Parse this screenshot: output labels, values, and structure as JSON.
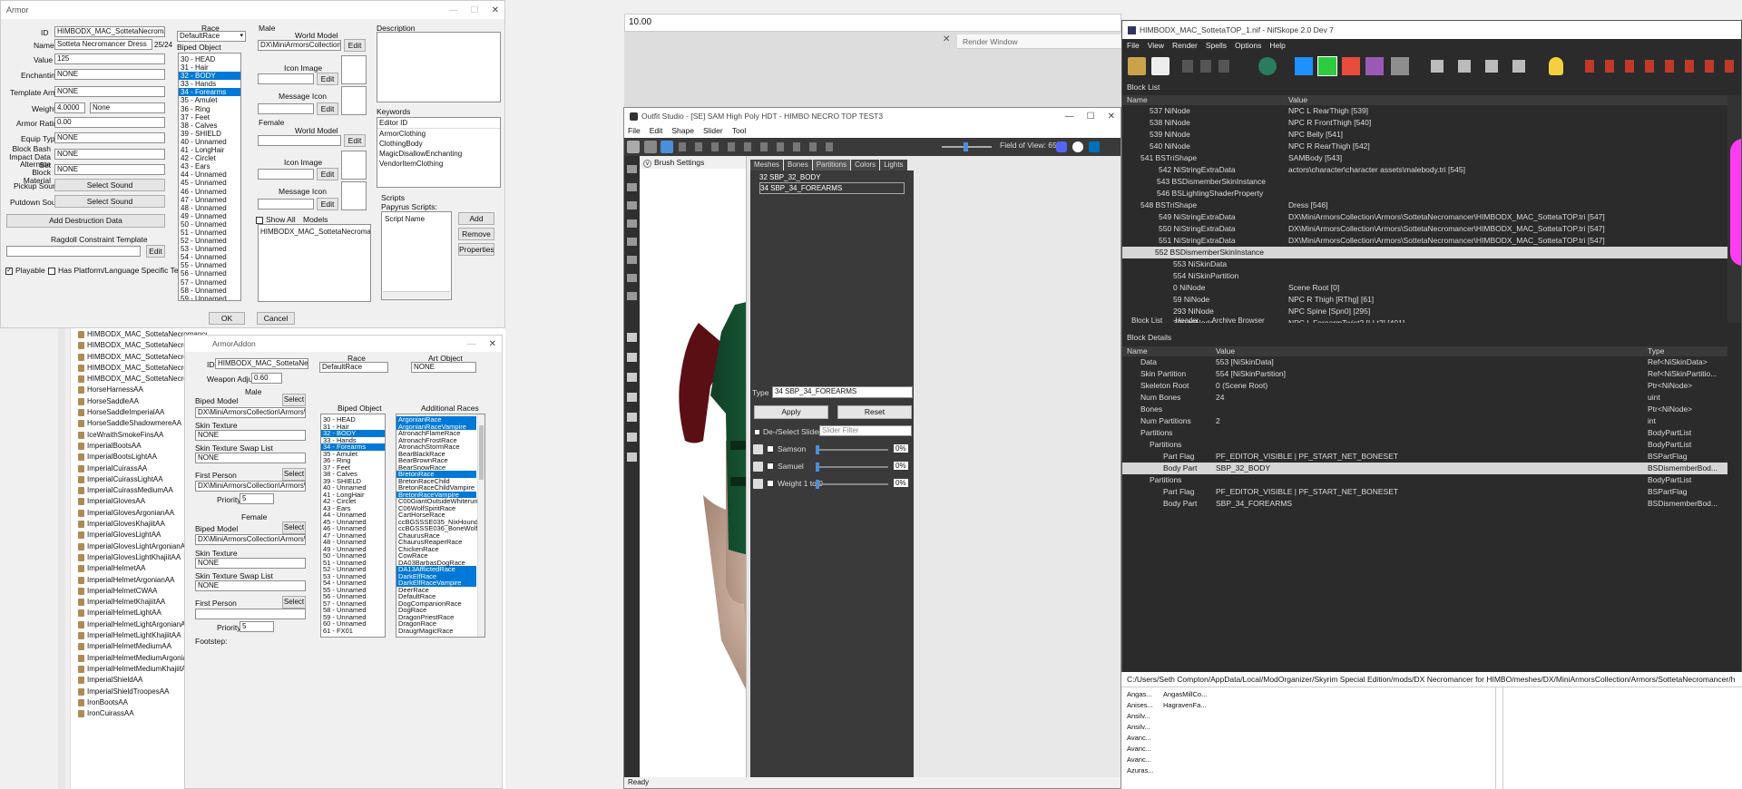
{
  "armor": {
    "title": "Armor",
    "id_label": "ID",
    "id_value": "HIMBODX_MAC_SottetaNecromancerDress",
    "name_label": "Name",
    "name_value": "Sotteta Necromancer Dress",
    "name_count": "25/24",
    "value_label": "Value",
    "value_value": "125",
    "enchanting_label": "Enchanting",
    "enchanting_value": "NONE",
    "template_label": "Template Armor",
    "template_value": "NONE",
    "weight_label": "Weight",
    "weight_value": "4.0000",
    "weight_type": "None",
    "rating_label": "Armor Rating",
    "rating_value": "0.00",
    "equip_label": "Equip Type",
    "equip_value": "NONE",
    "block_label": "Block Bash Impact Data Set",
    "block_value": "NONE",
    "altblock_label": "Alternate Block Material",
    "altblock_value": "NONE",
    "pickup_label": "Pickup Sound",
    "pickup_btn": "Select Sound",
    "putdown_label": "Putdown Sound",
    "putdown_btn": "Select Sound",
    "destruction_btn": "Add Destruction Data",
    "ragdoll_label": "Ragdoll Constraint Template",
    "edit_btn": "Edit",
    "playable_label": "Playable",
    "platform_label": "Has Platform/Language Specific Textures",
    "race_label": "Race",
    "race_value": "DefaultRace",
    "biped_label": "Biped Object",
    "biped_items": [
      "30 - HEAD",
      "31 - Hair",
      "32 - BODY",
      "33 - Hands",
      "34 - Forearms",
      "35 - Amulet",
      "36 - Ring",
      "37 - Feet",
      "38 - Calves",
      "39 - SHIELD",
      "40 - Unnamed",
      "41 - LongHair",
      "42 - Circlet",
      "43 - Ears",
      "44 - Unnamed",
      "45 - Unnamed",
      "46 - Unnamed",
      "47 - Unnamed",
      "48 - Unnamed",
      "49 - Unnamed",
      "50 - Unnamed",
      "51 - Unnamed",
      "52 - Unnamed",
      "53 - Unnamed",
      "54 - Unnamed",
      "55 - Unnamed",
      "56 - Unnamed",
      "57 - Unnamed",
      "58 - Unnamed",
      "59 - Unnamed",
      "60 - Unnamed",
      "61 - FX01"
    ],
    "male_label": "Male",
    "world_model_label": "World Model",
    "world_model_value": "DX\\MiniArmorsCollection\\Armors",
    "icon_image_label": "Icon Image",
    "message_icon_label": "Message Icon",
    "female_label": "Female",
    "show_all_label": "Show All",
    "models_label": "Models",
    "models_value": "HIMBODX_MAC_SottetaNecromance...",
    "description_label": "Description",
    "keywords_label": "Keywords",
    "editor_id_header": "Editor ID",
    "keywords": [
      "ArmorClothing",
      "ClothingBody",
      "MagicDisallowEnchanting",
      "VendorItemClothing"
    ],
    "scripts_label": "Scripts",
    "papyrus_label": "Papyrus Scripts:",
    "script_name_header": "Script Name",
    "add_btn": "Add",
    "remove_btn": "Remove",
    "properties_btn": "Properties",
    "ok_btn": "OK",
    "cancel_btn": "Cancel"
  },
  "sidebar_list": [
    "HIMBODX_MAC_SottetaNecromancerBo",
    "HIMBODX_MAC_SottetaNecromancerDr",
    "HIMBODX_MAC_SottetaNecromancerGl",
    "HIMBODX_MAC_SottetaNecromancerSo",
    "HIMBODX_MAC_SottetaNecromancerSt",
    "HorseHarnessAA",
    "HorseSaddleAA",
    "HorseSaddleImperialAA",
    "HorseSaddleShadowmereAA",
    "IceWraithSmokeFinsAA",
    "ImperialBootsAA",
    "ImperialBootsLightAA",
    "ImperialCuirassAA",
    "ImperialCuirassLightAA",
    "ImperialCuirassMediumAA",
    "ImperialGlovesAA",
    "ImperialGlovesArgonianAA",
    "ImperialGlovesKhajiitAA",
    "ImperialGlovesLightAA",
    "ImperialGlovesLightArgonianAA",
    "ImperialGlovesLightKhajiitAA",
    "ImperialHelmetAA",
    "ImperialHelmetArgonianAA",
    "ImperialHelmetCWAA",
    "ImperialHelmetKhajiitAA",
    "ImperialHelmetLightAA",
    "ImperialHelmetLightArgonianAA",
    "ImperialHelmetLightKhajiitAA",
    "ImperialHelmetMediumAA",
    "ImperialHelmetMediumArgonianAA",
    "ImperialHelmetMediumKhajiitAA",
    "ImperialShieldAA",
    "ImperialShieldTroopesAA",
    "IronBootsAA",
    "IronCuirassAA"
  ],
  "addon": {
    "title": "ArmorAddon",
    "id_label": "ID",
    "id_value": "HIMBODX_MAC_SottetaNecr",
    "weapon_adjust_label": "Weapon Adjust",
    "weapon_adjust_value": "0.60",
    "race_label": "Race",
    "race_value": "DefaultRace",
    "art_label": "Art Object",
    "art_value": "NONE",
    "male_label": "Male",
    "female_label": "Female",
    "biped_model_label": "Biped Model",
    "select_btn": "Select",
    "male_model_value": "DX\\MiniArmorsCollection\\Armors\\SottetaN",
    "skin_texture_label": "Skin Texture",
    "skin_value": "NONE",
    "skin_swap_label": "Skin Texture Swap List",
    "swap_value": "NONE",
    "first_person_label": "First Person",
    "first_person_value": "DX\\MiniArmorsCollection\\Armors\\SottetaN",
    "priority_label": "Priority",
    "priority_value": "5",
    "female_model_value": "DX\\MiniArmorsCollection\\Armors\\SottetaN",
    "female_priority_value": "5",
    "footstep_label": "Footstep:",
    "biped_label": "Biped Object",
    "additional_races_label": "Additional Races",
    "races": [
      "ArgonianRace",
      "ArgonianRaceVampire",
      "AtronachFlameRace",
      "AtronachFrostRace",
      "AtronachStormRace",
      "BearBlackRace",
      "BearBrownRace",
      "BearSnowRace",
      "BretonRace",
      "BretonRaceChild",
      "BretonRaceChildVampire",
      "BretonRaceVampire",
      "C00GiantOutsideWhiterunRace",
      "C06WolfSpiritRace",
      "CartHorseRace",
      "ccBGSSSE035_NixHoundCom",
      "ccBGSSSE036_BoneWolfCom",
      "ChaurusRace",
      "ChaurusReaperRace",
      "ChickenRace",
      "CowRace",
      "DA03BarbasDogRace",
      "DA13AfflictedRace",
      "DarkElfRace",
      "DarkElfRaceVampire",
      "DeerRace",
      "DefaultRace",
      "DogCompanionRace",
      "DogRace",
      "DragonPriestRace",
      "DragonRace",
      "DraugrMagicRace"
    ]
  },
  "value_bar": "10.00",
  "render_window": "Render Window",
  "outfit": {
    "title": "Outfit Studio - [SE] SAM High Poly HDT - HIMBO NECRO TOP TEST3",
    "menu": [
      "File",
      "Edit",
      "Shape",
      "Slider",
      "Tool"
    ],
    "fov_label": "Field of View: 65",
    "brush_settings": "Brush Settings",
    "tabs": [
      "Meshes",
      "Bones",
      "Partitions",
      "Colors",
      "Lights"
    ],
    "partitions": [
      "32 SBP_32_BODY",
      "34 SBP_34_FOREARMS"
    ],
    "type_label": "Type",
    "type_value": "34 SBP_34_FOREARMS",
    "apply_btn": "Apply",
    "reset_btn": "Reset",
    "deselect_label": "De-/Select Sliders",
    "slider_filter": "Slider Filter",
    "sliders": [
      {
        "name": "Samson",
        "pct": "0%"
      },
      {
        "name": "Samuel",
        "pct": "0%"
      },
      {
        "name": "Weight 1 to 0",
        "pct": "0%"
      }
    ],
    "status": "Ready"
  },
  "nifskope": {
    "title": "HIMBODX_MAC_SottetaTOP_1.nif - NifSkope 2.0 Dev 7",
    "menu": [
      "File",
      "View",
      "Render",
      "Spells",
      "Options",
      "Help"
    ],
    "block_list_label": "Block List",
    "col_name": "Name",
    "col_value": "Value",
    "col_type": "Type",
    "rows": [
      {
        "name": "537 NiNode",
        "value": "NPC L RearThigh [539]"
      },
      {
        "name": "538 NiNode",
        "value": "NPC R FrontThigh [540]"
      },
      {
        "name": "539 NiNode",
        "value": "NPC Belly [541]"
      },
      {
        "name": "540 NiNode",
        "value": "NPC R RearThigh [542]"
      },
      {
        "name": "541 BSTriShape",
        "value": "SAMBody [543]"
      },
      {
        "name": "542 NiStringExtraData",
        "value": "actors\\character\\character assets\\malebody.tri [545]"
      },
      {
        "name": "543 BSDismemberSkinInstance",
        "value": ""
      },
      {
        "name": "546 BSLightingShaderProperty",
        "value": ""
      },
      {
        "name": "548 BSTriShape",
        "value": "Dress [546]"
      },
      {
        "name": "549 NiStringExtraData",
        "value": "DX\\MiniArmorsCollection\\Armors\\SottetaNecromancer\\HIMBODX_MAC_SottetaTOP.tri [547]"
      },
      {
        "name": "550 NiStringExtraData",
        "value": "DX\\MiniArmorsCollection\\Armors\\SottetaNecromancer\\HIMBODX_MAC_SottetaTOP.tri [547]"
      },
      {
        "name": "551 NiStringExtraData",
        "value": "DX\\MiniArmorsCollection\\Armors\\SottetaNecromancer\\HIMBODX_MAC_SottetaTOP.tri [547]"
      },
      {
        "name": "552 BSDismemberSkinInstance",
        "value": ""
      },
      {
        "name": "553 NiSkinData",
        "value": ""
      },
      {
        "name": "554 NiSkinPartition",
        "value": ""
      },
      {
        "name": "0 NiNode",
        "value": "Scene Root [0]"
      },
      {
        "name": "59 NiNode",
        "value": "NPC R Thigh [RThg] [61]"
      },
      {
        "name": "293 NiNode",
        "value": "NPC Spine [Spn0] [295]"
      },
      {
        "name": "399 NiNode",
        "value": "NPC L ForearmTwist2 [LLt2] [401]"
      },
      {
        "name": "530 NiNode",
        "value": "NPC R UpperarmTwist1 [RUt1] [532]"
      },
      {
        "name": "297 NiNode",
        "value": "NPC Spine2 [Spn2] [299]"
      },
      {
        "name": "295 NiNode",
        "value": "NPC Spine1 [Spn1] [297]"
      }
    ],
    "bottom_tabs": [
      "Block List",
      "Header",
      "Archive Browser"
    ],
    "details_label": "Block Details",
    "details": [
      {
        "name": "Data",
        "value": "553 [NiSkinData]",
        "type": "Ref<NiSkinData>"
      },
      {
        "name": "Skin Partition",
        "value": "554 [NiSkinPartition]",
        "type": "Ref<NiSkinPartitio..."
      },
      {
        "name": "Skeleton Root",
        "value": "0 (Scene Root)",
        "type": "Ptr<NiNode>"
      },
      {
        "name": "Num Bones",
        "value": "24",
        "type": "uint"
      },
      {
        "name": "Bones",
        "value": "",
        "type": "Ptr<NiNode>"
      },
      {
        "name": "Num Partitions",
        "value": "2",
        "type": "int"
      },
      {
        "name": "Partitions",
        "value": "",
        "type": "BodyPartList"
      },
      {
        "name": "Partitions",
        "value": "",
        "type": "BodyPartList"
      },
      {
        "name": "Part Flag",
        "value": "PF_EDITOR_VISIBLE | PF_START_NET_BONESET",
        "type": "BSPartFlag"
      },
      {
        "name": "Body Part",
        "value": "SBP_32_BODY",
        "type": "BSDismemberBod..."
      },
      {
        "name": "Partitions",
        "value": "",
        "type": "BodyPartList"
      },
      {
        "name": "Part Flag",
        "value": "PF_EDITOR_VISIBLE | PF_START_NET_BONESET",
        "type": "BSPartFlag"
      },
      {
        "name": "Body Part",
        "value": "SBP_34_FOREARMS",
        "type": "BSDismemberBod..."
      }
    ],
    "path": "C:/Users/Seth Compton/AppData/Local/ModOrganizer/Skyrim Special Edition/mods/DX Necromancer for HIMBO/meshes/DX/MiniArmorsCollection/Armors/SottetaNecromancer/h"
  },
  "grid": [
    [
      "Angas...",
      "AngasMillCo..."
    ],
    [
      "Anises...",
      "HagravenFa..."
    ],
    [
      "Ansilv...",
      ""
    ],
    [
      "Ansilv...",
      ""
    ],
    [
      "Avanc...",
      ""
    ],
    [
      "Avanc...",
      ""
    ],
    [
      "Avanc...",
      ""
    ],
    [
      "Azuras...",
      ""
    ]
  ]
}
